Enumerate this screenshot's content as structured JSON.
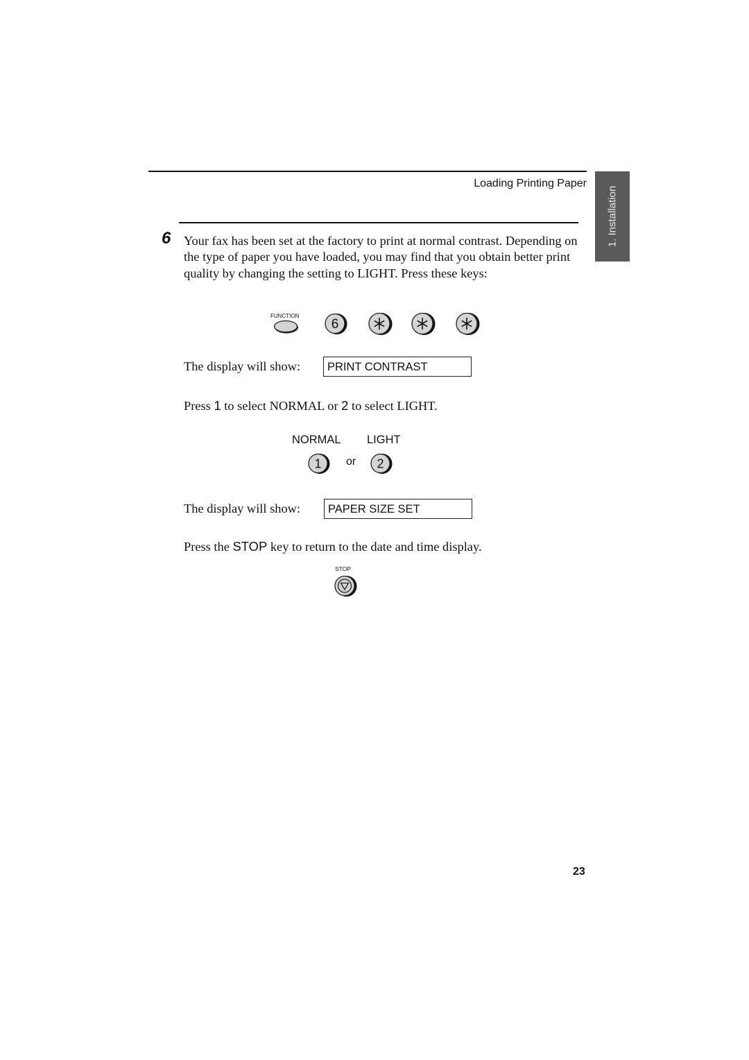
{
  "header": {
    "running_head": "Loading Printing Paper",
    "side_tab": "1. Installation"
  },
  "step": {
    "number": "6",
    "paragraph": "Your fax has been set at the factory to print at normal contrast. Depending on the type of paper you have loaded, you may find that you obtain better print quality by changing the setting to LIGHT. Press these keys:"
  },
  "keys_sequence": {
    "function_label": "FUNCTION",
    "keys": [
      {
        "icon": "key-6-icon",
        "label": "6"
      },
      {
        "icon": "key-asterisk-icon",
        "label": "*"
      },
      {
        "icon": "key-asterisk-icon",
        "label": "*"
      },
      {
        "icon": "key-asterisk-icon",
        "label": "*"
      }
    ]
  },
  "display1": {
    "prefix": "The display will show:",
    "value": "PRINT CONTRAST"
  },
  "select_instruction": {
    "part1": "Press ",
    "key1": "1",
    "part2": " to select NORMAL or ",
    "key2": "2",
    "part3": " to select LIGHT."
  },
  "options": {
    "normal_label": "NORMAL",
    "light_label": "LIGHT",
    "key1": "1",
    "or": "or",
    "key2": "2"
  },
  "display2": {
    "prefix": "The display will show:",
    "value": "PAPER SIZE SET"
  },
  "stop_instruction": {
    "part1": "Press the ",
    "key": "STOP",
    "part2": " key to return to the date and time display."
  },
  "stop_key": {
    "label": "STOP",
    "icon": "stop-key-icon"
  },
  "footer": {
    "page_number": "23"
  },
  "colors": {
    "text": "#111111",
    "side_tab_bg": "#5a5a5a",
    "side_tab_text": "#eaeaea",
    "key_fill": "#d4d4d4"
  }
}
